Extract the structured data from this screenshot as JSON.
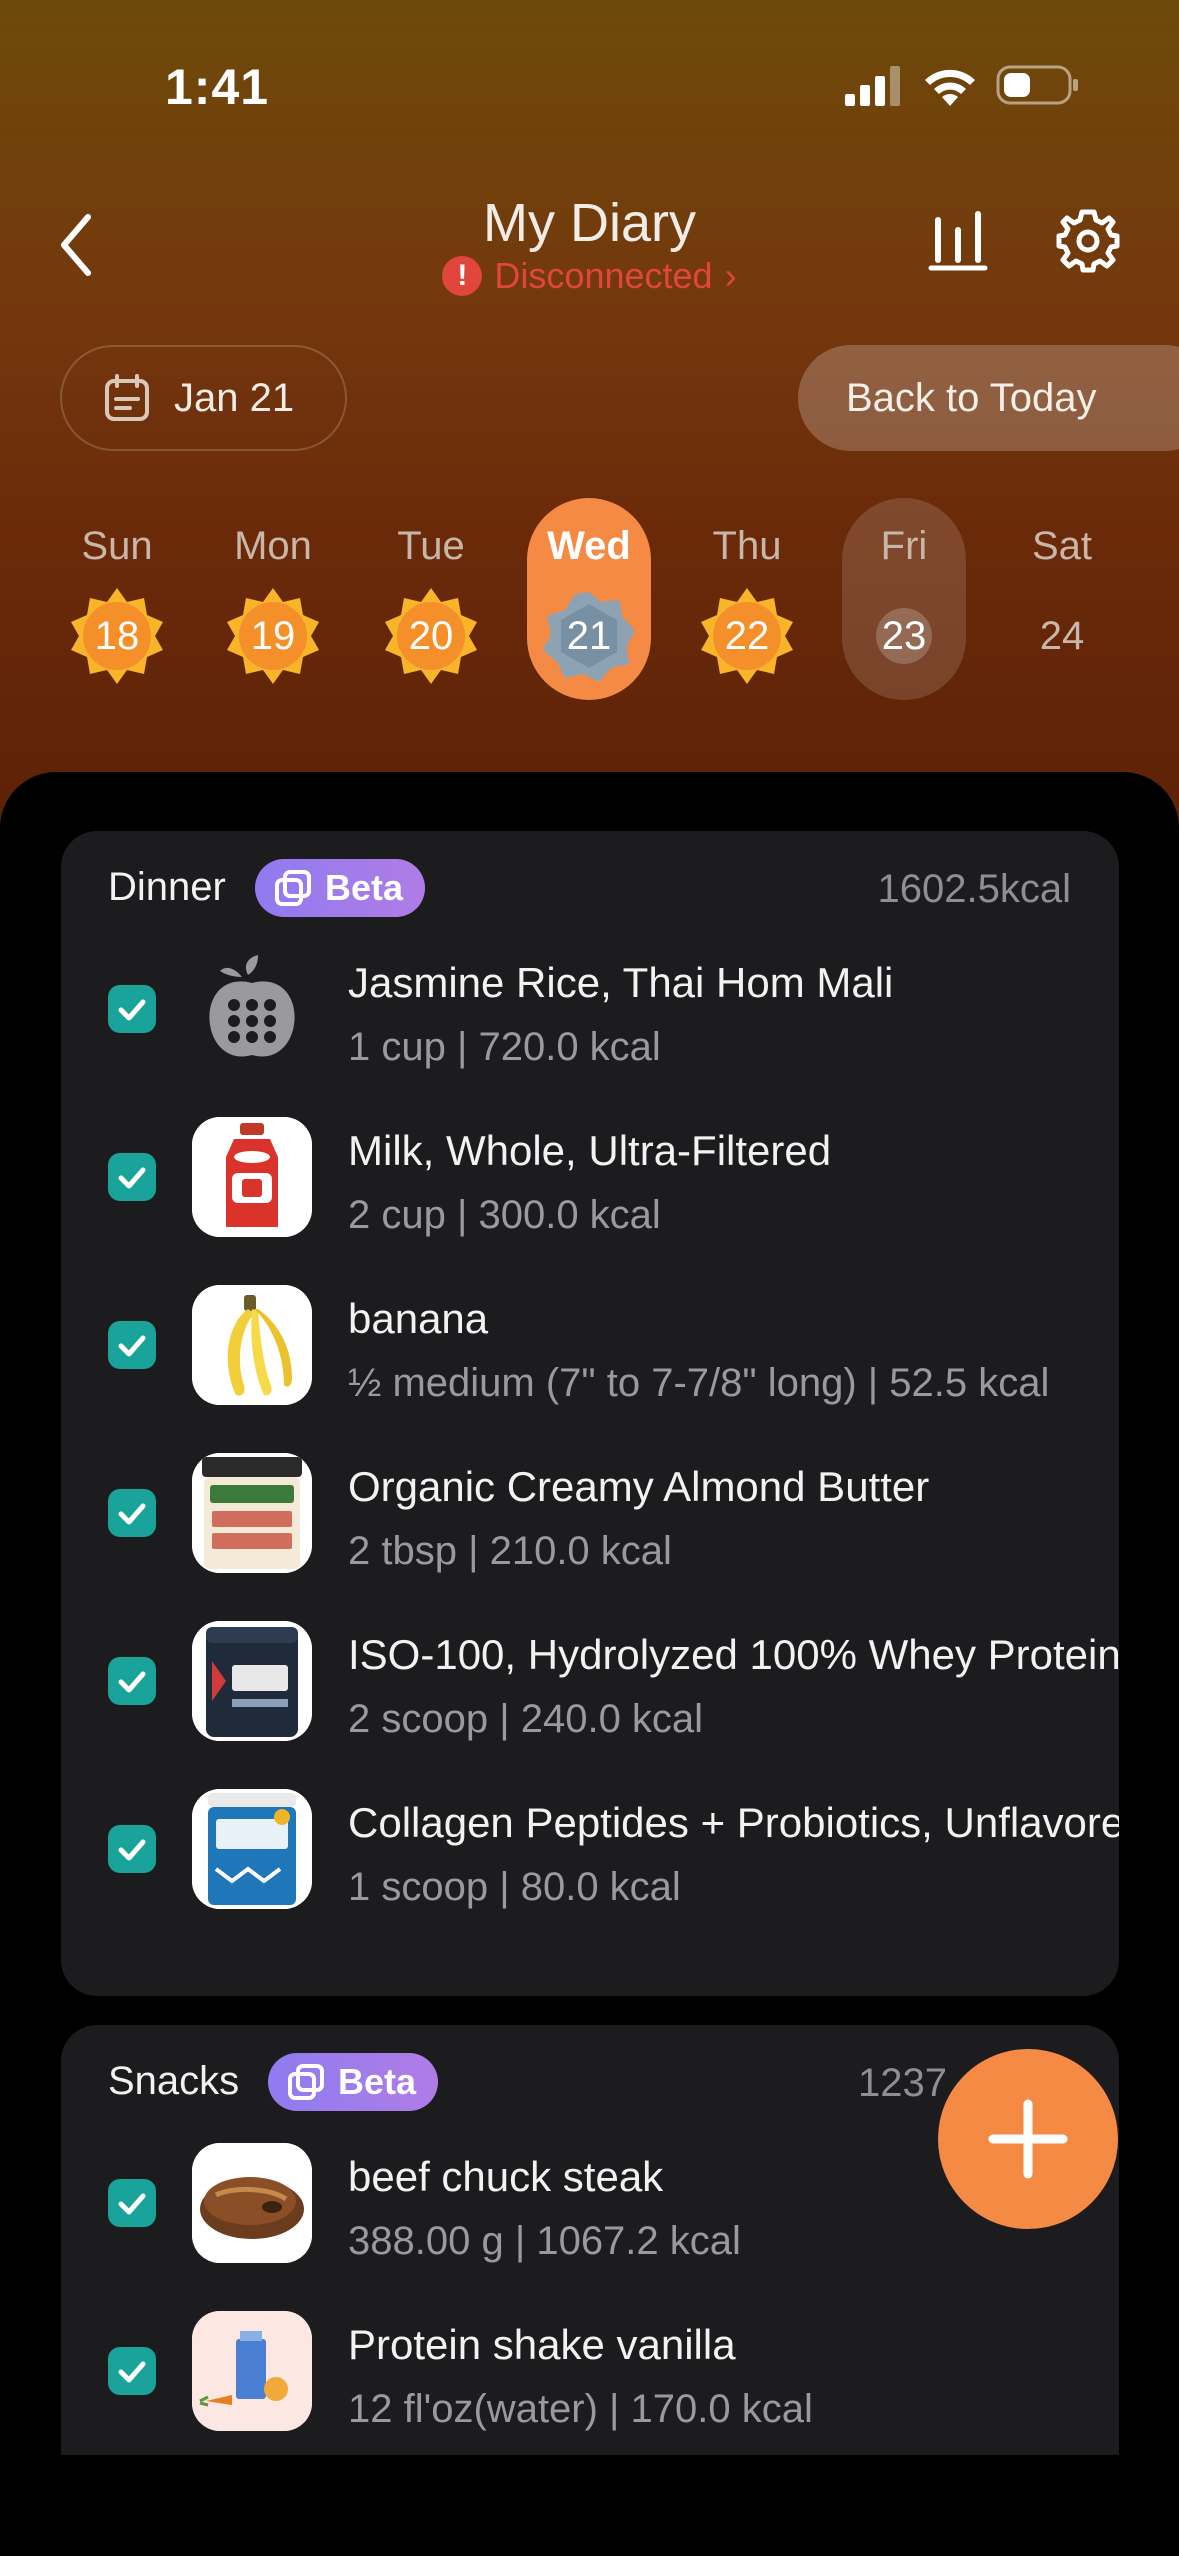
{
  "status_bar": {
    "time": "1:41"
  },
  "nav": {
    "title": "My Diary",
    "connection_status": "Disconnected",
    "connection_chevron": "›"
  },
  "date_selector": {
    "current_date": "Jan 21",
    "back_to_today": "Back to Today"
  },
  "week": [
    {
      "label": "Sun",
      "day": "18",
      "state": "badge"
    },
    {
      "label": "Mon",
      "day": "19",
      "state": "badge"
    },
    {
      "label": "Tue",
      "day": "20",
      "state": "badge"
    },
    {
      "label": "Wed",
      "day": "21",
      "state": "selected"
    },
    {
      "label": "Thu",
      "day": "22",
      "state": "badge"
    },
    {
      "label": "Fri",
      "day": "23",
      "state": "today"
    },
    {
      "label": "Sat",
      "day": "24",
      "state": "plain"
    }
  ],
  "meals": [
    {
      "name": "Dinner",
      "badge": "Beta",
      "kcal": "1602.5kcal",
      "items": [
        {
          "name": "Jasmine Rice, Thai Hom Mali",
          "detail": "1 cup | 720.0 kcal",
          "image": "apple-placeholder-icon"
        },
        {
          "name": "Milk, Whole, Ultra-Filtered",
          "detail": "2 cup | 300.0 kcal",
          "image": "milk-bottle-image"
        },
        {
          "name": "banana",
          "detail": "½ medium (7\" to 7-7/8\" long) | 52.5 kcal",
          "image": "banana-image"
        },
        {
          "name": "Organic Creamy Almond Butter",
          "detail": "2 tbsp | 210.0 kcal",
          "image": "almond-butter-jar-image"
        },
        {
          "name": "ISO-100, Hydrolyzed 100% Whey Protein",
          "detail": "2 scoop | 240.0 kcal",
          "image": "protein-tub-image"
        },
        {
          "name": "Collagen Peptides + Probiotics, Unflavored",
          "detail": "1 scoop | 80.0 kcal",
          "image": "collagen-tub-image"
        }
      ]
    },
    {
      "name": "Snacks",
      "badge": "Beta",
      "kcal": "1237",
      "items": [
        {
          "name": "beef chuck steak",
          "detail": "388.00 g | 1067.2 kcal",
          "image": "steak-image"
        },
        {
          "name": "Protein shake vanilla",
          "detail": "12 fl'oz(water) | 170.0 kcal",
          "image": "groceries-image"
        }
      ]
    }
  ],
  "colors": {
    "accent": "#f58a45",
    "check": "#1aa39a",
    "badge_star": "#f9b52a",
    "error": "#e0463c",
    "card": "#1c1c1e"
  }
}
